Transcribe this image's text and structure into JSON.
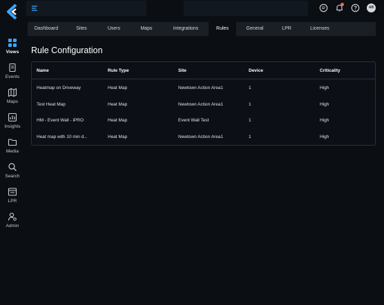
{
  "sidebar": {
    "items": [
      {
        "label": "Views",
        "icon": "grid-icon",
        "active": true
      },
      {
        "label": "Events",
        "icon": "events-icon",
        "active": false
      },
      {
        "label": "Maps",
        "icon": "map-icon",
        "active": false
      },
      {
        "label": "Insights",
        "icon": "insights-icon",
        "active": false
      },
      {
        "label": "Media",
        "icon": "folder-icon",
        "active": false
      },
      {
        "label": "Search",
        "icon": "search-icon",
        "active": false
      },
      {
        "label": "LPR",
        "icon": "lpr-icon",
        "active": false
      },
      {
        "label": "Admin",
        "icon": "admin-icon",
        "active": false
      }
    ]
  },
  "topbar": {
    "avatar_initials": "AB"
  },
  "tabs": [
    {
      "label": "Dashboard",
      "active": false
    },
    {
      "label": "Sites",
      "active": false
    },
    {
      "label": "Users",
      "active": false
    },
    {
      "label": "Maps",
      "active": false
    },
    {
      "label": "Integrations",
      "active": false
    },
    {
      "label": "Rules",
      "active": true
    },
    {
      "label": "General",
      "active": false
    },
    {
      "label": "LPR",
      "active": false
    },
    {
      "label": "Licenses",
      "active": false
    }
  ],
  "page": {
    "title": "Rule Configuration"
  },
  "table": {
    "headers": {
      "name": "Name",
      "rule_type": "Rule Type",
      "site": "Site",
      "device": "Device",
      "criticality": "Criticality"
    },
    "rows": [
      {
        "name": "Heatmap on Driveway",
        "rule_type": "Heat Map",
        "site": "Newtown Action Area1",
        "device": "1",
        "criticality": "High"
      },
      {
        "name": "Test Heat Map",
        "rule_type": "Heat Map",
        "site": "Newtown Action Area1",
        "device": "1",
        "criticality": "High"
      },
      {
        "name": "HM - Event Wall - iPRO",
        "rule_type": "Heat Map",
        "site": "Event Wall Test",
        "device": "1",
        "criticality": "High"
      },
      {
        "name": "Heat map with 10 min d...",
        "rule_type": "Heat Map",
        "site": "Newtown Action Area1",
        "device": "1",
        "criticality": "High"
      }
    ]
  },
  "colors": {
    "background": "#0b0f14",
    "accent": "#3ea6ff",
    "notification": "#ef6c4a"
  }
}
